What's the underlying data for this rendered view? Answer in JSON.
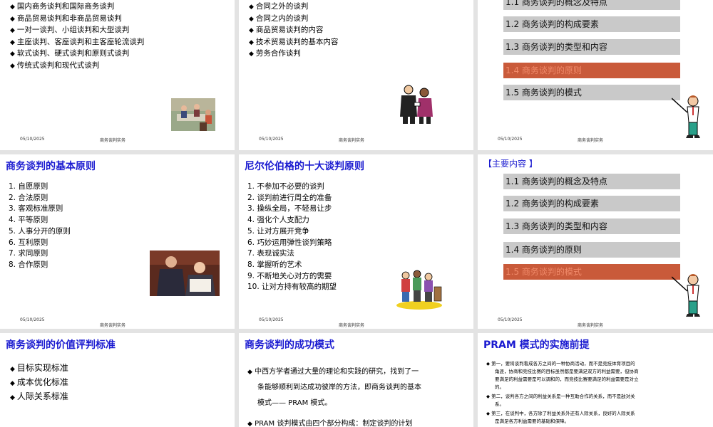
{
  "footer": {
    "date": "05/10/2025",
    "name": "商务谈判实务"
  },
  "slide1": {
    "items": [
      "国内商务谈判和国际商务谈判",
      "商品贸易谈判和非商品贸易谈判",
      "一对一谈判、小组谈判和大型谈判",
      "主座谈判、客座谈判和主客座轮流谈判",
      "软式谈判、硬式谈判和原则式谈判",
      "传统式谈判和现代式谈判"
    ]
  },
  "slide2": {
    "items": [
      "合同之外的谈判",
      "合同之内的谈判",
      "商品贸易谈判的内容",
      "技术贸易谈判的基本内容",
      "劳务合作谈判"
    ]
  },
  "slide3": {
    "items": [
      "1.1 商务谈判的概念及特点",
      "1.2 商务谈判的构成要素",
      "1.3 商务谈判的类型和内容",
      "1.4 商务谈判的原则",
      "1.5 商务谈判的模式"
    ],
    "active_index": 3
  },
  "slide4": {
    "title": "商务谈判的基本原则",
    "items": [
      "1. 自愿原则",
      "2. 合法原则",
      "3. 客观标准原则",
      "4. 平等原则",
      "5. 人事分开的原则",
      "6. 互利原则",
      "7. 求同原则",
      "8. 合作原则"
    ]
  },
  "slide5": {
    "title": "尼尔伦伯格的十大谈判原则",
    "items": [
      "1. 不参加不必要的谈判",
      "2. 谈判前进行周全的准备",
      "3. 操纵全局，不轻易让步",
      "4. 强化个人支配力",
      "5. 让对方展开竞争",
      "6. 巧妙运用弹性谈判策略",
      "7. 表现诚实法",
      "8. 掌握听的艺术",
      "9. 不断地关心对方的需要",
      "10. 让对方持有较高的期望"
    ]
  },
  "slide6": {
    "heading": "【主要内容 】",
    "items": [
      "1.1 商务谈判的概念及特点",
      "1.2 商务谈判的构成要素",
      "1.3 商务谈判的类型和内容",
      "1.4 商务谈判的原则",
      "1.5 商务谈判的模式"
    ],
    "active_index": 4
  },
  "slide7": {
    "title": "商务谈判的价值评判标准",
    "items": [
      "目标实现标准",
      "成本优化标准",
      "人际关系标准"
    ]
  },
  "slide8": {
    "title": "商务谈判的成功模式",
    "para1_l1": "中西方学者通过大量的理论和实践的研究，找到了一",
    "para1_l2": "条能够顺利到达成功彼岸的方法，即商务谈判的基本",
    "para1_l3": "模式—— PRAM 模式。",
    "para2": "PRAM 谈判模式由四个部分构成：制定谈判的计划"
  },
  "slide9": {
    "title": "PRAM 模式的实施前提",
    "p1_l1": "第一，要将谈判看成各方之间的一种协商活动，而不是竞技体育项目的",
    "p1_l2": "角逐，协商和竞技比赛的目标虽然都是要满足双方的利益需要，但协商",
    "p1_l3": "要满足的利益需要是可以调和的，而竞技比赛要满足的利益需要是对立",
    "p1_l4": "的。",
    "p2_l1": "第二，谈判各方之间的利益关系是一种互助合作的关系，而不是敌对关",
    "p2_l2": "系。",
    "p3_l1": "第三，在谈判中，各方除了利益关系外还有人际关系，良好的人际关系",
    "p3_l2": "是满足各方利益需要的基础和保障。"
  }
}
